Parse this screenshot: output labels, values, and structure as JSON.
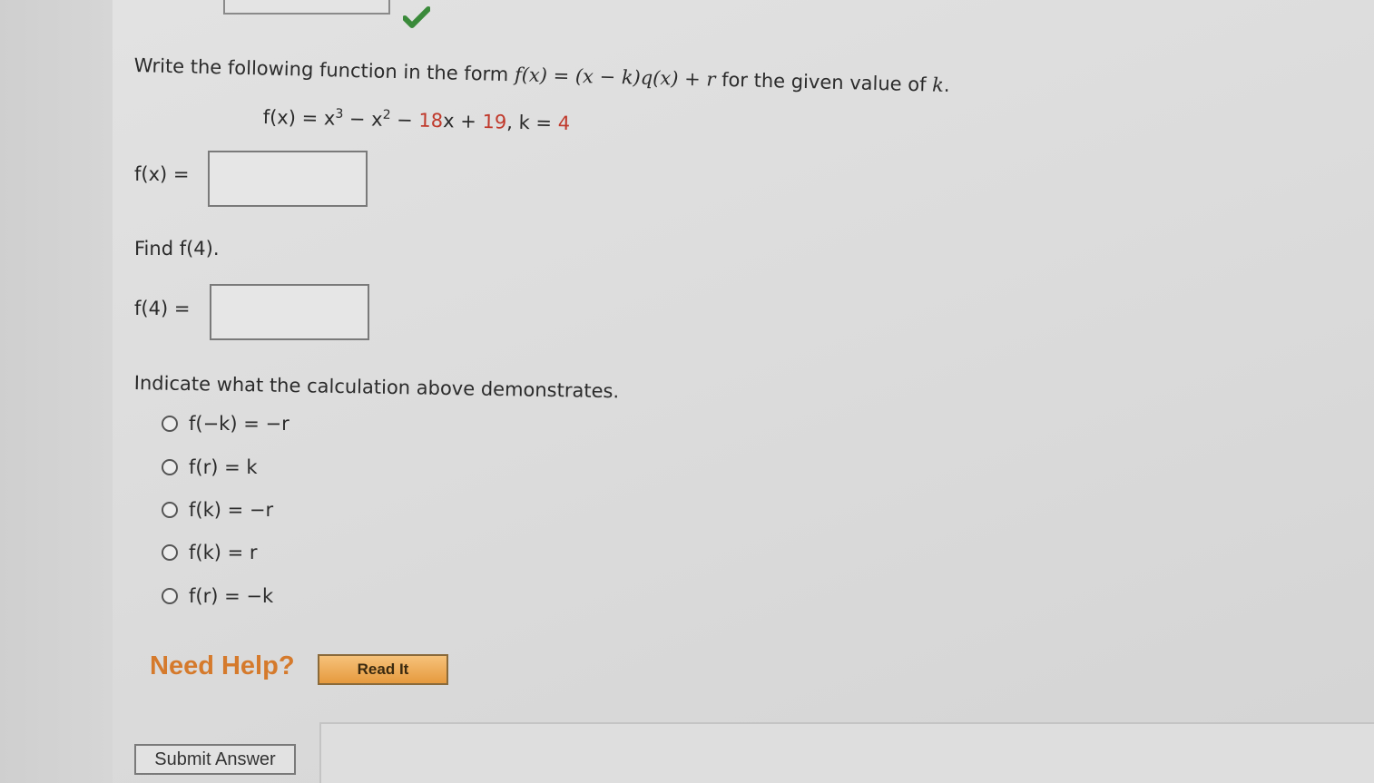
{
  "instruction": {
    "prefix": "Write the following function in the form ",
    "form": "f(x) = (x − k)q(x) + r",
    "suffix": " for the given value of ",
    "var": "k",
    "end": "."
  },
  "given": {
    "fx": "f(x) = x",
    "exp3": "3",
    "mid": " − x",
    "exp2": "2",
    "rest": " − ",
    "coef": "18",
    "x_plus": "x + ",
    "const": "19",
    "sep": ",  k = ",
    "k": "4"
  },
  "part1": {
    "label": "f(x) =",
    "value": ""
  },
  "find": {
    "label": "Find f(4)."
  },
  "part2": {
    "label": "f(4) =",
    "value": ""
  },
  "question": "Indicate what the calculation above demonstrates.",
  "options": [
    "f(−k) = −r",
    "f(r) = k",
    "f(k) = −r",
    "f(k) = r",
    "f(r) = −k"
  ],
  "help": {
    "title": "Need Help?",
    "read_it": "Read It"
  },
  "submit": "Submit Answer",
  "colors": {
    "accent_orange": "#d57a2c",
    "check_green": "#3a8a3a",
    "red": "#c0392b"
  }
}
